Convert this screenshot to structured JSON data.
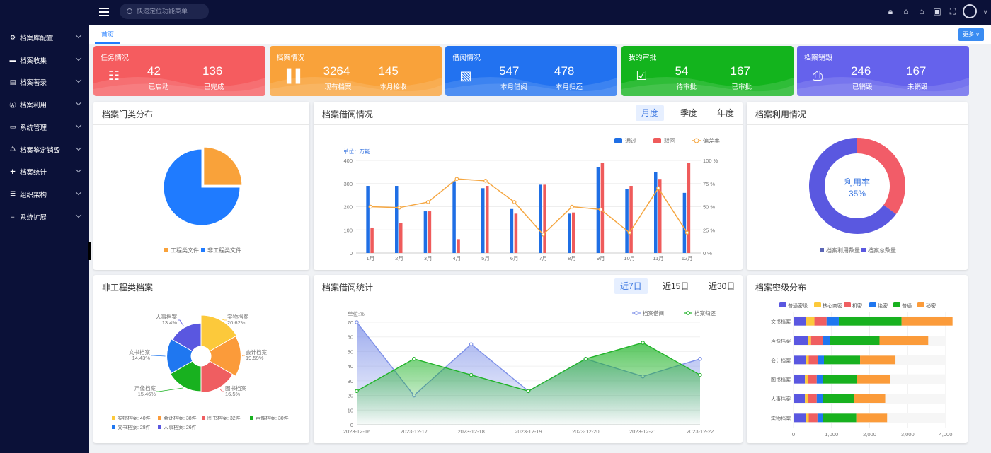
{
  "topbar": {
    "search_placeholder": "快速定位功能菜单",
    "icons": [
      "lock-icon",
      "shirt-icon",
      "bell-icon",
      "screen-icon",
      "fullscreen-icon",
      "avatar"
    ]
  },
  "sidebar": {
    "items": [
      {
        "label": "档案库配置",
        "icon": "gear-icon"
      },
      {
        "label": "档案收集",
        "icon": "box-icon"
      },
      {
        "label": "档案著录",
        "icon": "calendar-icon"
      },
      {
        "label": "档案利用",
        "icon": "badge-icon"
      },
      {
        "label": "系统管理",
        "icon": "monitor-icon"
      },
      {
        "label": "档案鉴定销毁",
        "icon": "recycle-icon"
      },
      {
        "label": "档案统计",
        "icon": "cross-icon"
      },
      {
        "label": "组织架构",
        "icon": "org-icon"
      },
      {
        "label": "系统扩展",
        "icon": "list-icon"
      }
    ]
  },
  "tabs": {
    "home": "首页",
    "more": "更多"
  },
  "stats": [
    {
      "title": "任务情况",
      "color": "#f55c5f",
      "icon": "clipboard-icon",
      "values": [
        {
          "num": "42",
          "label": "已启动"
        },
        {
          "num": "136",
          "label": "已完成"
        }
      ]
    },
    {
      "title": "档案情况",
      "color": "#f9a23a",
      "icon": "binder-icon",
      "values": [
        {
          "num": "3264",
          "label": "现有档案"
        },
        {
          "num": "145",
          "label": "本月接收"
        }
      ]
    },
    {
      "title": "借阅情况",
      "color": "#2272f0",
      "icon": "book-icon",
      "values": [
        {
          "num": "547",
          "label": "本月借阅"
        },
        {
          "num": "478",
          "label": "本月归还"
        }
      ]
    },
    {
      "title": "我的审批",
      "color": "#13b41d",
      "icon": "approve-icon",
      "values": [
        {
          "num": "54",
          "label": "待审批"
        },
        {
          "num": "167",
          "label": "已审批"
        }
      ]
    },
    {
      "title": "档案销毁",
      "color": "#6562ec",
      "icon": "shredder-icon",
      "values": [
        {
          "num": "246",
          "label": "已销毁"
        },
        {
          "num": "167",
          "label": "未销毁"
        }
      ]
    }
  ],
  "cards": {
    "category": {
      "title": "档案门类分布"
    },
    "borrow": {
      "title": "档案借阅情况",
      "tabs": [
        "月度",
        "季度",
        "年度"
      ],
      "active": 0
    },
    "usage": {
      "title": "档案利用情况",
      "center_label": "利用率",
      "center_value": "35%"
    },
    "nonproj": {
      "title": "非工程类档案"
    },
    "borrow_stat": {
      "title": "档案借阅统计",
      "tabs": [
        "近7日",
        "近15日",
        "近30日"
      ],
      "active": 0
    },
    "secret": {
      "title": "档案密级分布"
    }
  },
  "chart_data": [
    {
      "type": "pie",
      "title": "档案门类分布",
      "categories": [
        "工程类文件",
        "非工程类文件"
      ],
      "values": [
        25,
        75
      ],
      "colors": [
        "#f9a23a",
        "#1f7bff"
      ]
    },
    {
      "type": "bar",
      "title": "档案借阅情况",
      "unit_label": "单位：万耗",
      "categories": [
        "1月",
        "2月",
        "3月",
        "4月",
        "5月",
        "6月",
        "7月",
        "8月",
        "9月",
        "10月",
        "11月",
        "12月"
      ],
      "ylim": [
        0,
        400
      ],
      "yticks": [
        0,
        100,
        200,
        300,
        400
      ],
      "y2ticks": [
        "0 %",
        "25 %",
        "50 %",
        "75 %",
        "100 %"
      ],
      "series": [
        {
          "name": "通过",
          "color": "#1f6fe5",
          "values": [
            290,
            290,
            180,
            310,
            280,
            190,
            295,
            170,
            370,
            275,
            350,
            260
          ]
        },
        {
          "name": "驳回",
          "color": "#ef5b5b",
          "values": [
            110,
            130,
            180,
            60,
            290,
            170,
            295,
            175,
            390,
            290,
            320,
            390
          ]
        },
        {
          "name": "偏差率",
          "color": "#f5a640",
          "type": "line",
          "axis": "right",
          "values": [
            50,
            49,
            55,
            80,
            78,
            55,
            20,
            50,
            47,
            22,
            70,
            22
          ]
        }
      ]
    },
    {
      "type": "pie",
      "subtype": "donut",
      "title": "档案利用情况",
      "categories": [
        "档案利用数量",
        "档案总数量"
      ],
      "values": [
        35,
        65
      ],
      "colors": [
        "#f25c68",
        "#5a58e0"
      ],
      "legend": [
        "档案利用数量",
        "档案总数量"
      ],
      "legend_colors": [
        "#5a65b5",
        "#5a58e0"
      ]
    },
    {
      "type": "pie",
      "subtype": "rose",
      "title": "非工程类档案",
      "categories": [
        "实物档案",
        "会计档案",
        "图书档案",
        "声像档案",
        "文书档案",
        "人事档案"
      ],
      "values": [
        40,
        38,
        32,
        30,
        28,
        26
      ],
      "percents": [
        "20.62%",
        "19.59%",
        "16.5%",
        "15.46%",
        "14.43%",
        "13.4%"
      ],
      "legend": [
        "实物档案: 40件",
        "会计档案: 38件",
        "图书档案: 32件",
        "声像档案: 30件",
        "文书档案: 28件",
        "人事档案: 26件"
      ],
      "colors": [
        "#fcc93b",
        "#fb9b3a",
        "#ef5e61",
        "#18b11f",
        "#1f77f0",
        "#5a57e0"
      ]
    },
    {
      "type": "area",
      "title": "档案借阅统计",
      "unit_label": "单位:%",
      "x": [
        "2023-12-16",
        "2023-12-17",
        "2023-12-18",
        "2023-12-19",
        "2023-12-20",
        "2023-12-21",
        "2023-12-22"
      ],
      "ylim": [
        0,
        70
      ],
      "yticks": [
        0,
        10,
        20,
        30,
        40,
        50,
        60,
        70
      ],
      "series": [
        {
          "name": "档案借阅",
          "color": "#7d90e8",
          "values": [
            70,
            20,
            55,
            23,
            45,
            33,
            45
          ]
        },
        {
          "name": "档案归还",
          "color": "#21b429",
          "values": [
            23,
            45,
            34,
            23,
            45,
            56,
            34
          ]
        }
      ]
    },
    {
      "type": "bar",
      "subtype": "stacked-horizontal",
      "title": "档案密级分布",
      "categories": [
        "实物档案",
        "人事档案",
        "图书档案",
        "会计档案",
        "声像档案",
        "文书档案"
      ],
      "xlim": [
        0,
        4000
      ],
      "xticks": [
        "0",
        "1,000",
        "2,000",
        "3,000",
        "4,000"
      ],
      "series": [
        {
          "name": "普通密级",
          "color": "#5a57e0",
          "values": [
            320,
            300,
            300,
            320,
            380,
            330
          ]
        },
        {
          "name": "核心商密",
          "color": "#fcc93b",
          "values": [
            80,
            80,
            80,
            80,
            80,
            220
          ]
        },
        {
          "name": "机密",
          "color": "#ef5e61",
          "values": [
            230,
            230,
            230,
            250,
            320,
            320
          ]
        },
        {
          "name": "绝密",
          "color": "#1f77f0",
          "values": [
            140,
            160,
            170,
            150,
            180,
            320
          ]
        },
        {
          "name": "普通",
          "color": "#18b11f",
          "values": [
            880,
            820,
            880,
            950,
            1300,
            1650
          ]
        },
        {
          "name": "秘密",
          "color": "#fb9b3a",
          "values": [
            810,
            820,
            880,
            930,
            1280,
            1340
          ]
        }
      ]
    }
  ]
}
